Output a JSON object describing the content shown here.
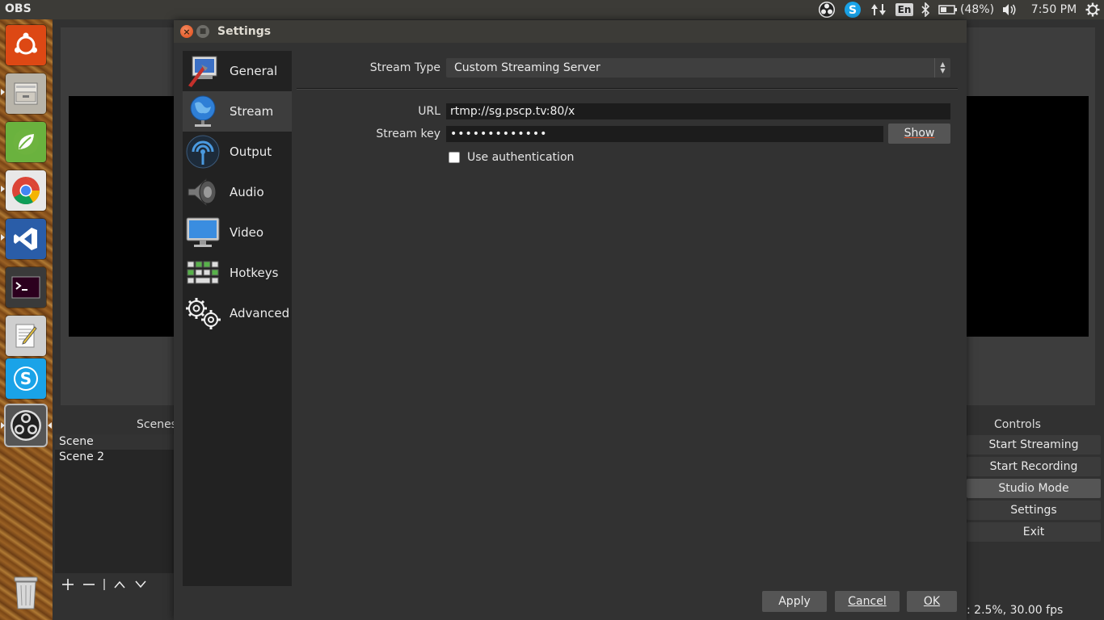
{
  "top_panel": {
    "app_title": "OBS",
    "lang": "En",
    "battery": "(48%)",
    "clock": "7:50 PM"
  },
  "launcher": {
    "items": [
      "ubuntu-dash",
      "files",
      "spring-tool-suite",
      "chrome",
      "visual-studio-code",
      "terminal",
      "text-editor",
      "skype",
      "obs-studio",
      "trash"
    ]
  },
  "obs_main": {
    "scenes_title": "Scenes",
    "scenes": [
      "Scene",
      "Scene 2"
    ],
    "controls_title": "Controls",
    "controls": [
      "Start Streaming",
      "Start Recording",
      "Studio Mode",
      "Settings",
      "Exit"
    ],
    "status": ": 2.5%, 30.00 fps"
  },
  "settings": {
    "title": "Settings",
    "sidebar": [
      {
        "label": "General",
        "icon": "general-icon"
      },
      {
        "label": "Stream",
        "icon": "stream-globe-icon"
      },
      {
        "label": "Output",
        "icon": "output-icon"
      },
      {
        "label": "Audio",
        "icon": "speaker-icon"
      },
      {
        "label": "Video",
        "icon": "monitor-icon"
      },
      {
        "label": "Hotkeys",
        "icon": "keyboard-icon"
      },
      {
        "label": "Advanced",
        "icon": "gears-icon"
      }
    ],
    "selected_section": "Stream",
    "stream_type_label": "Stream Type",
    "stream_type_value": "Custom Streaming Server",
    "url_label": "URL",
    "url_value": "rtmp://sg.pscp.tv:80/x",
    "stream_key_label": "Stream key",
    "stream_key_value": "•••••••••••••",
    "show_button": "Show",
    "use_auth_label": "Use authentication",
    "use_auth_checked": false,
    "buttons": {
      "apply": "Apply",
      "cancel": "Cancel",
      "ok": "OK"
    }
  }
}
